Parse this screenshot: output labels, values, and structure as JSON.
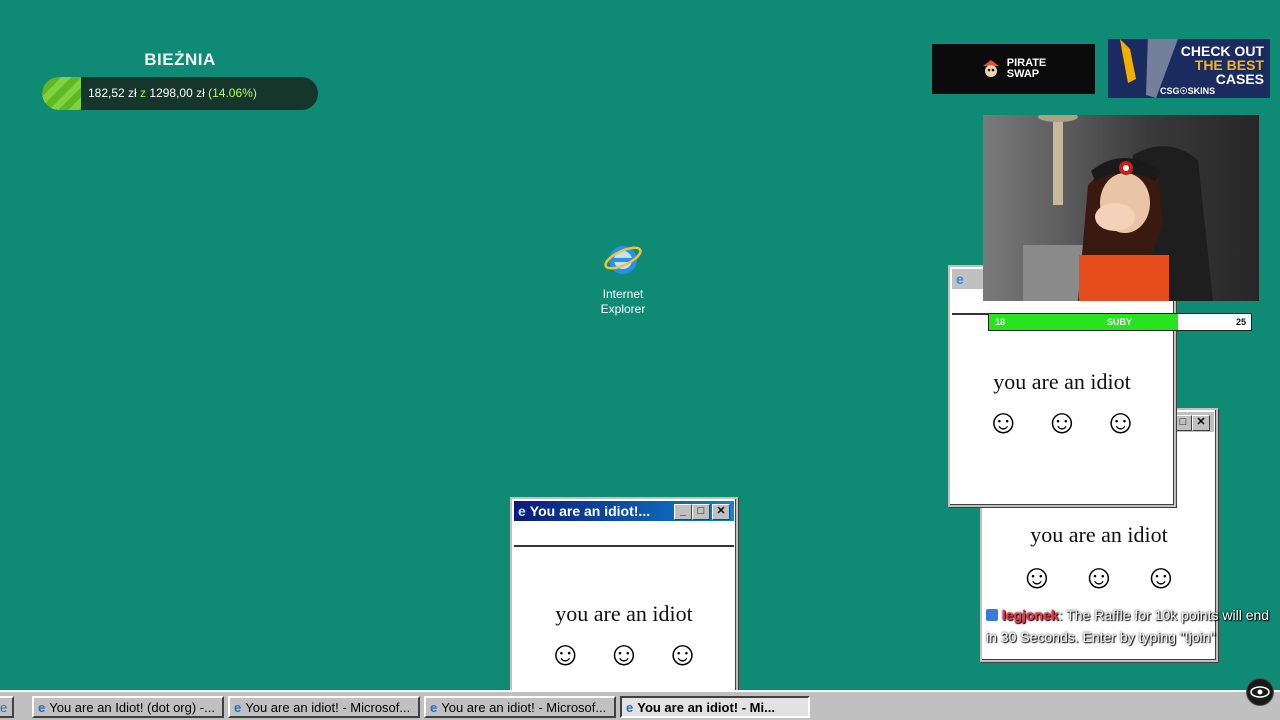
{
  "goal": {
    "title": "BIEŻNIA",
    "current": "182,52 zł",
    "sep": "z",
    "target": "1298,00 zł",
    "percent": "(14.06%)",
    "progress_fraction": 0.1406
  },
  "desktop_icons": [
    {
      "label_line1": "Internet",
      "label_line2": "Explorer",
      "icon": "internet-explorer-icon"
    }
  ],
  "sponsors": {
    "pirate": {
      "line1": "PIRATE",
      "line2": "SWAP"
    },
    "csgo": {
      "line1": "CHECK OUT",
      "line2": "THE BEST",
      "line3": "CASES",
      "line4": "CSG☉SKINS"
    }
  },
  "sub_bar": {
    "left_value": "18",
    "label": "SUBY",
    "right_value": "25",
    "progress_fraction": 0.72
  },
  "popup_windows": [
    {
      "title": "You are an idiot!...",
      "message": "you are an idiot",
      "faces": [
        "☺",
        "☺",
        "☺"
      ]
    },
    {
      "title": "",
      "message": "you are an idiot",
      "faces": [
        "☺",
        "☺",
        "☺"
      ]
    },
    {
      "title": "",
      "message": "you are an idiot",
      "faces": [
        "☺",
        "☺",
        "☺"
      ]
    }
  ],
  "chat": {
    "username": "legjonek",
    "message": ": The Raffle for 10k points will end in 30 Seconds. Enter by typing \"!join\""
  },
  "taskbar": {
    "items": [
      {
        "label": "You are an Idiot! (dot org) -...",
        "active": false
      },
      {
        "label": "You are an idiot! - Microsof...",
        "active": false
      },
      {
        "label": "You are an idiot! - Microsof...",
        "active": false
      },
      {
        "label": "You are an idiot! - Mi...",
        "active": true
      }
    ]
  },
  "colors": {
    "desktop": "#0e8a75",
    "titlebar": "#0a1a7a",
    "goal_fill": "#7fd33f",
    "sub_fill": "#28e320"
  }
}
